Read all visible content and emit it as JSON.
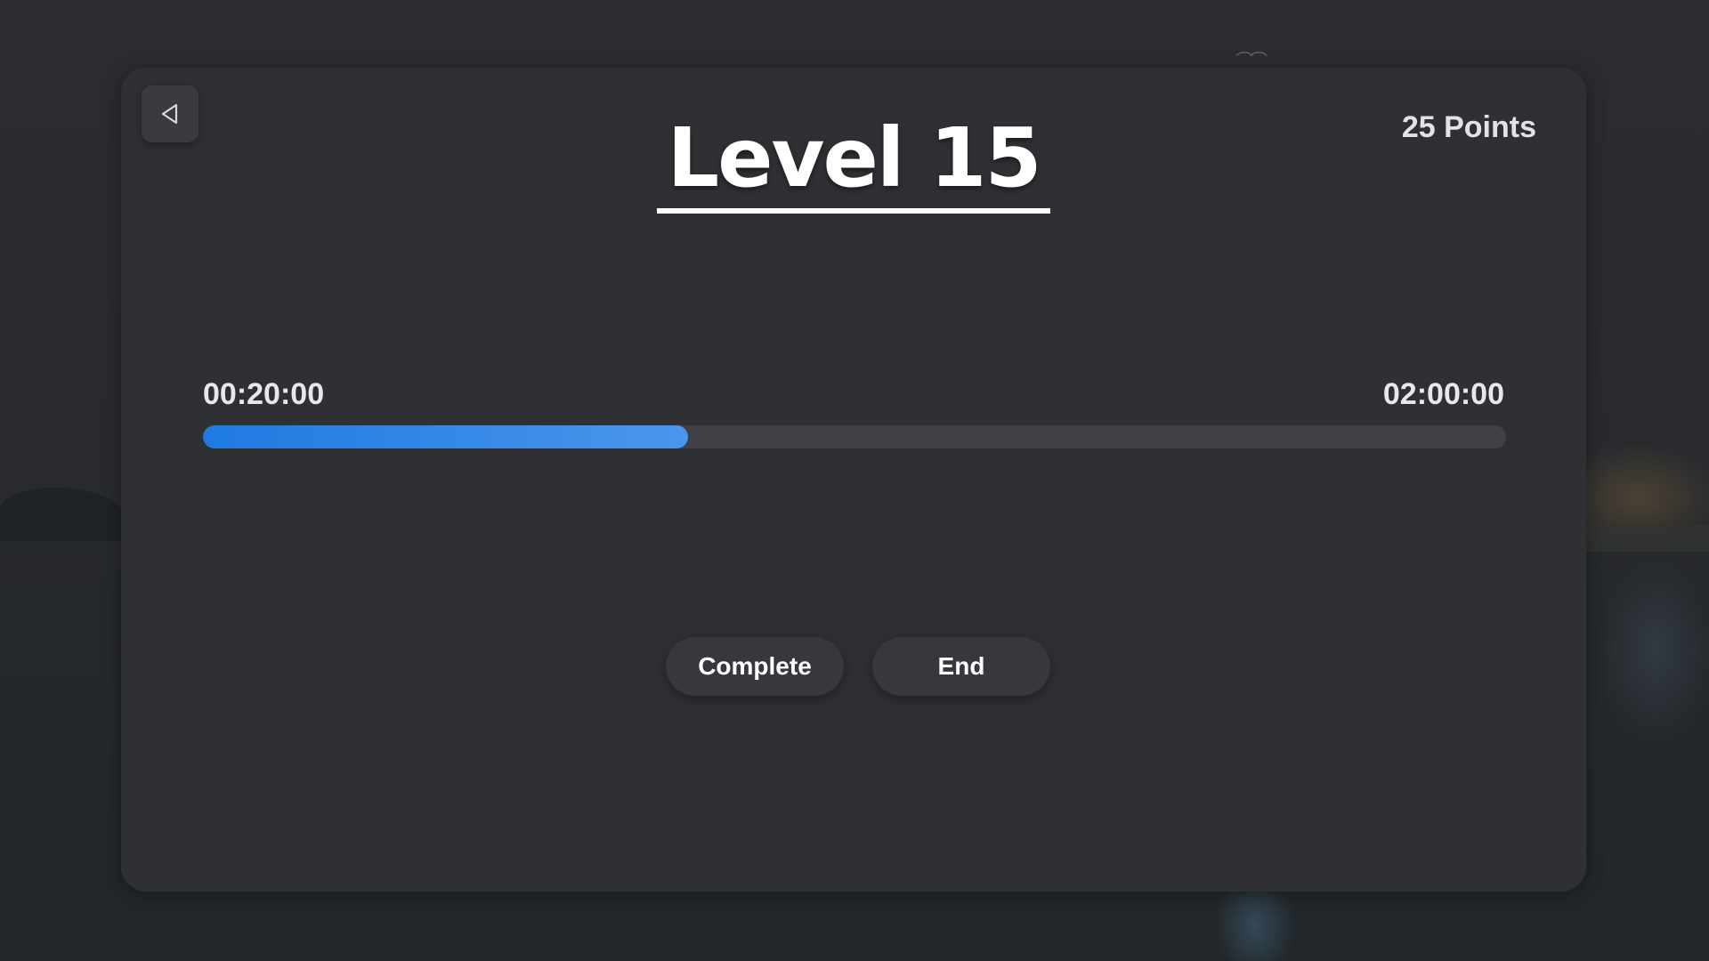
{
  "header": {
    "back_icon": "back-triangle-icon",
    "title": "Level 15",
    "points": "25 Points"
  },
  "timer": {
    "elapsed": "00:20:00",
    "total": "02:00:00",
    "progress_percent": 37.2,
    "progress_color_start": "#1f7ae0",
    "progress_color_end": "#4a96ec"
  },
  "actions": {
    "complete_label": "Complete",
    "end_label": "End"
  }
}
